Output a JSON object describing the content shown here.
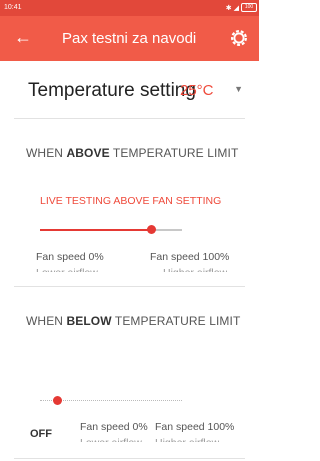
{
  "status_bar": {
    "time": "10:41",
    "battery": "100"
  },
  "app_bar": {
    "title": "Pax testni za navodi",
    "back_icon": "back-arrow-icon",
    "settings_icon": "gear-icon"
  },
  "temperature_setting": {
    "label": "Temperature setting",
    "value": "25°C"
  },
  "above_section": {
    "title_prefix": "WHEN ",
    "title_bold": "ABOVE",
    "title_suffix": " TEMPERATURE LIMIT",
    "live_label": "LIVE TESTING ABOVE FAN SETTING",
    "slider_value": 0.78,
    "min_label": "Fan speed 0%",
    "max_label": "Fan speed 100%",
    "min_sub": "Lower airflow",
    "max_sub": "Higher airflow"
  },
  "below_section": {
    "title_prefix": "WHEN ",
    "title_bold": "BELOW",
    "title_suffix": " TEMPERATURE LIMIT",
    "slider_value": 0.12,
    "status": "OFF",
    "min_label": "Fan speed 0%",
    "max_label": "Fan speed 100%",
    "min_sub": "Lower airflow",
    "max_sub": "Higher airflow"
  },
  "colors": {
    "status_bar": "#e2483a",
    "app_bar": "#f15b48",
    "accent": "#e53934"
  }
}
